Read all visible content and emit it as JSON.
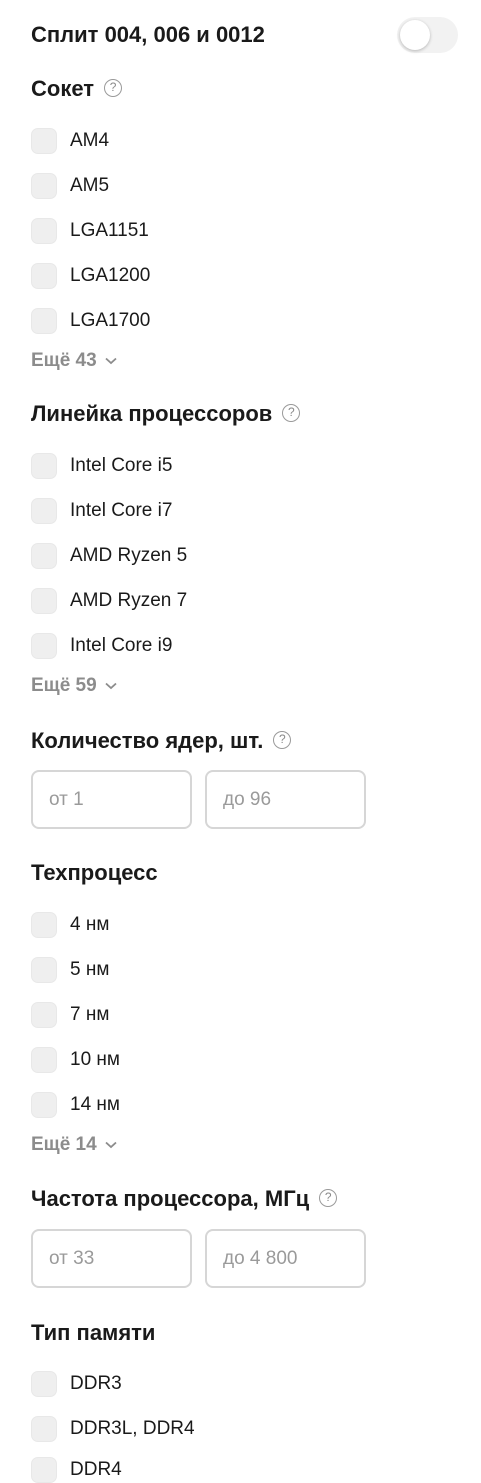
{
  "split": {
    "label": "Сплит 004, 006 и 0012",
    "enabled": false
  },
  "help_glyph": "?",
  "socket": {
    "title": "Сокет",
    "items": [
      "AM4",
      "AM5",
      "LGA1151",
      "LGA1200",
      "LGA1700"
    ],
    "more": "Ещё 43"
  },
  "cpu_line": {
    "title": "Линейка процессоров",
    "items": [
      "Intel Core i5",
      "Intel Core i7",
      "AMD Ryzen 5",
      "AMD Ryzen 7",
      "Intel Core i9"
    ],
    "more": "Ещё 59"
  },
  "cores": {
    "title": "Количество ядер, шт.",
    "from_placeholder": "от 1",
    "to_placeholder": "до 96"
  },
  "process": {
    "title": "Техпроцесс",
    "items": [
      "4 нм",
      "5 нм",
      "7 нм",
      "10 нм",
      "14 нм"
    ],
    "more": "Ещё 14"
  },
  "frequency": {
    "title": "Частота процессора, МГц",
    "from_placeholder": "от 33",
    "to_placeholder": "до 4 800"
  },
  "memory": {
    "title": "Тип памяти",
    "items": [
      "DDR3",
      "DDR3L, DDR4",
      "DDR4"
    ]
  }
}
